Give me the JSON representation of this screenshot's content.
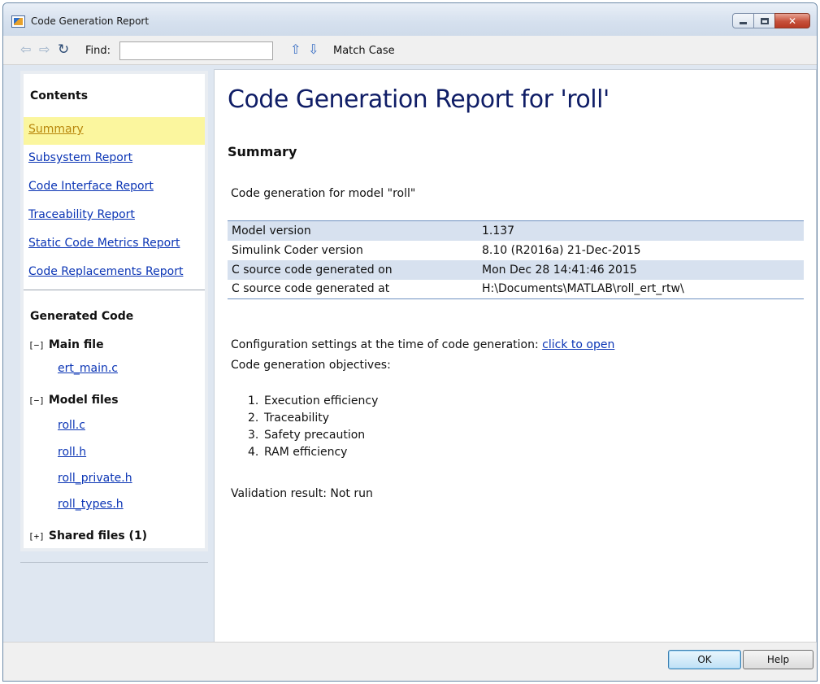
{
  "window": {
    "title": "Code Generation Report"
  },
  "toolbar": {
    "find_label": "Find:",
    "find_value": "",
    "match_case_label": "Match Case"
  },
  "sidebar": {
    "contents_heading": "Contents",
    "links": [
      {
        "label": "Summary",
        "active": true
      },
      {
        "label": "Subsystem Report",
        "active": false
      },
      {
        "label": "Code Interface Report",
        "active": false
      },
      {
        "label": "Traceability Report",
        "active": false
      },
      {
        "label": "Static Code Metrics Report",
        "active": false
      },
      {
        "label": "Code Replacements Report",
        "active": false
      }
    ],
    "generated_heading": "Generated Code",
    "groups": [
      {
        "toggle": "[−]",
        "label": "Main file",
        "files": [
          "ert_main.c"
        ]
      },
      {
        "toggle": "[−]",
        "label": "Model files",
        "files": [
          "roll.c",
          "roll.h",
          "roll_private.h",
          "roll_types.h"
        ]
      },
      {
        "toggle": "[+]",
        "label": "Shared files (1)",
        "files": []
      }
    ]
  },
  "main": {
    "title": "Code Generation Report for 'roll'",
    "section_heading": "Summary",
    "intro": "Code generation for model \"roll\"",
    "info_rows": [
      {
        "key": "Model version",
        "value": "1.137"
      },
      {
        "key": "Simulink Coder version",
        "value": "8.10 (R2016a) 21-Dec-2015"
      },
      {
        "key": "C source code generated on",
        "value": "Mon Dec 28 14:41:46 2015"
      },
      {
        "key": "C source code generated at",
        "value": "H:\\Documents\\MATLAB\\roll_ert_rtw\\"
      }
    ],
    "config_text": "Configuration settings at the time of code generation: ",
    "config_link": "click to open",
    "objectives_label": "Code generation objectives:",
    "objectives": [
      {
        "num": "1.",
        "text": "Execution efficiency"
      },
      {
        "num": "2.",
        "text": "Traceability"
      },
      {
        "num": "3.",
        "text": "Safety precaution"
      },
      {
        "num": "4.",
        "text": "RAM efficiency"
      }
    ],
    "validation": "Validation result: Not run"
  },
  "buttons": {
    "ok": "OK",
    "help": "Help"
  },
  "colors": {
    "title_color": "#0f1d66",
    "link_color": "#0b35b5",
    "active_highlight": "#fbf69e",
    "row_shade": "#d7e1ef"
  }
}
